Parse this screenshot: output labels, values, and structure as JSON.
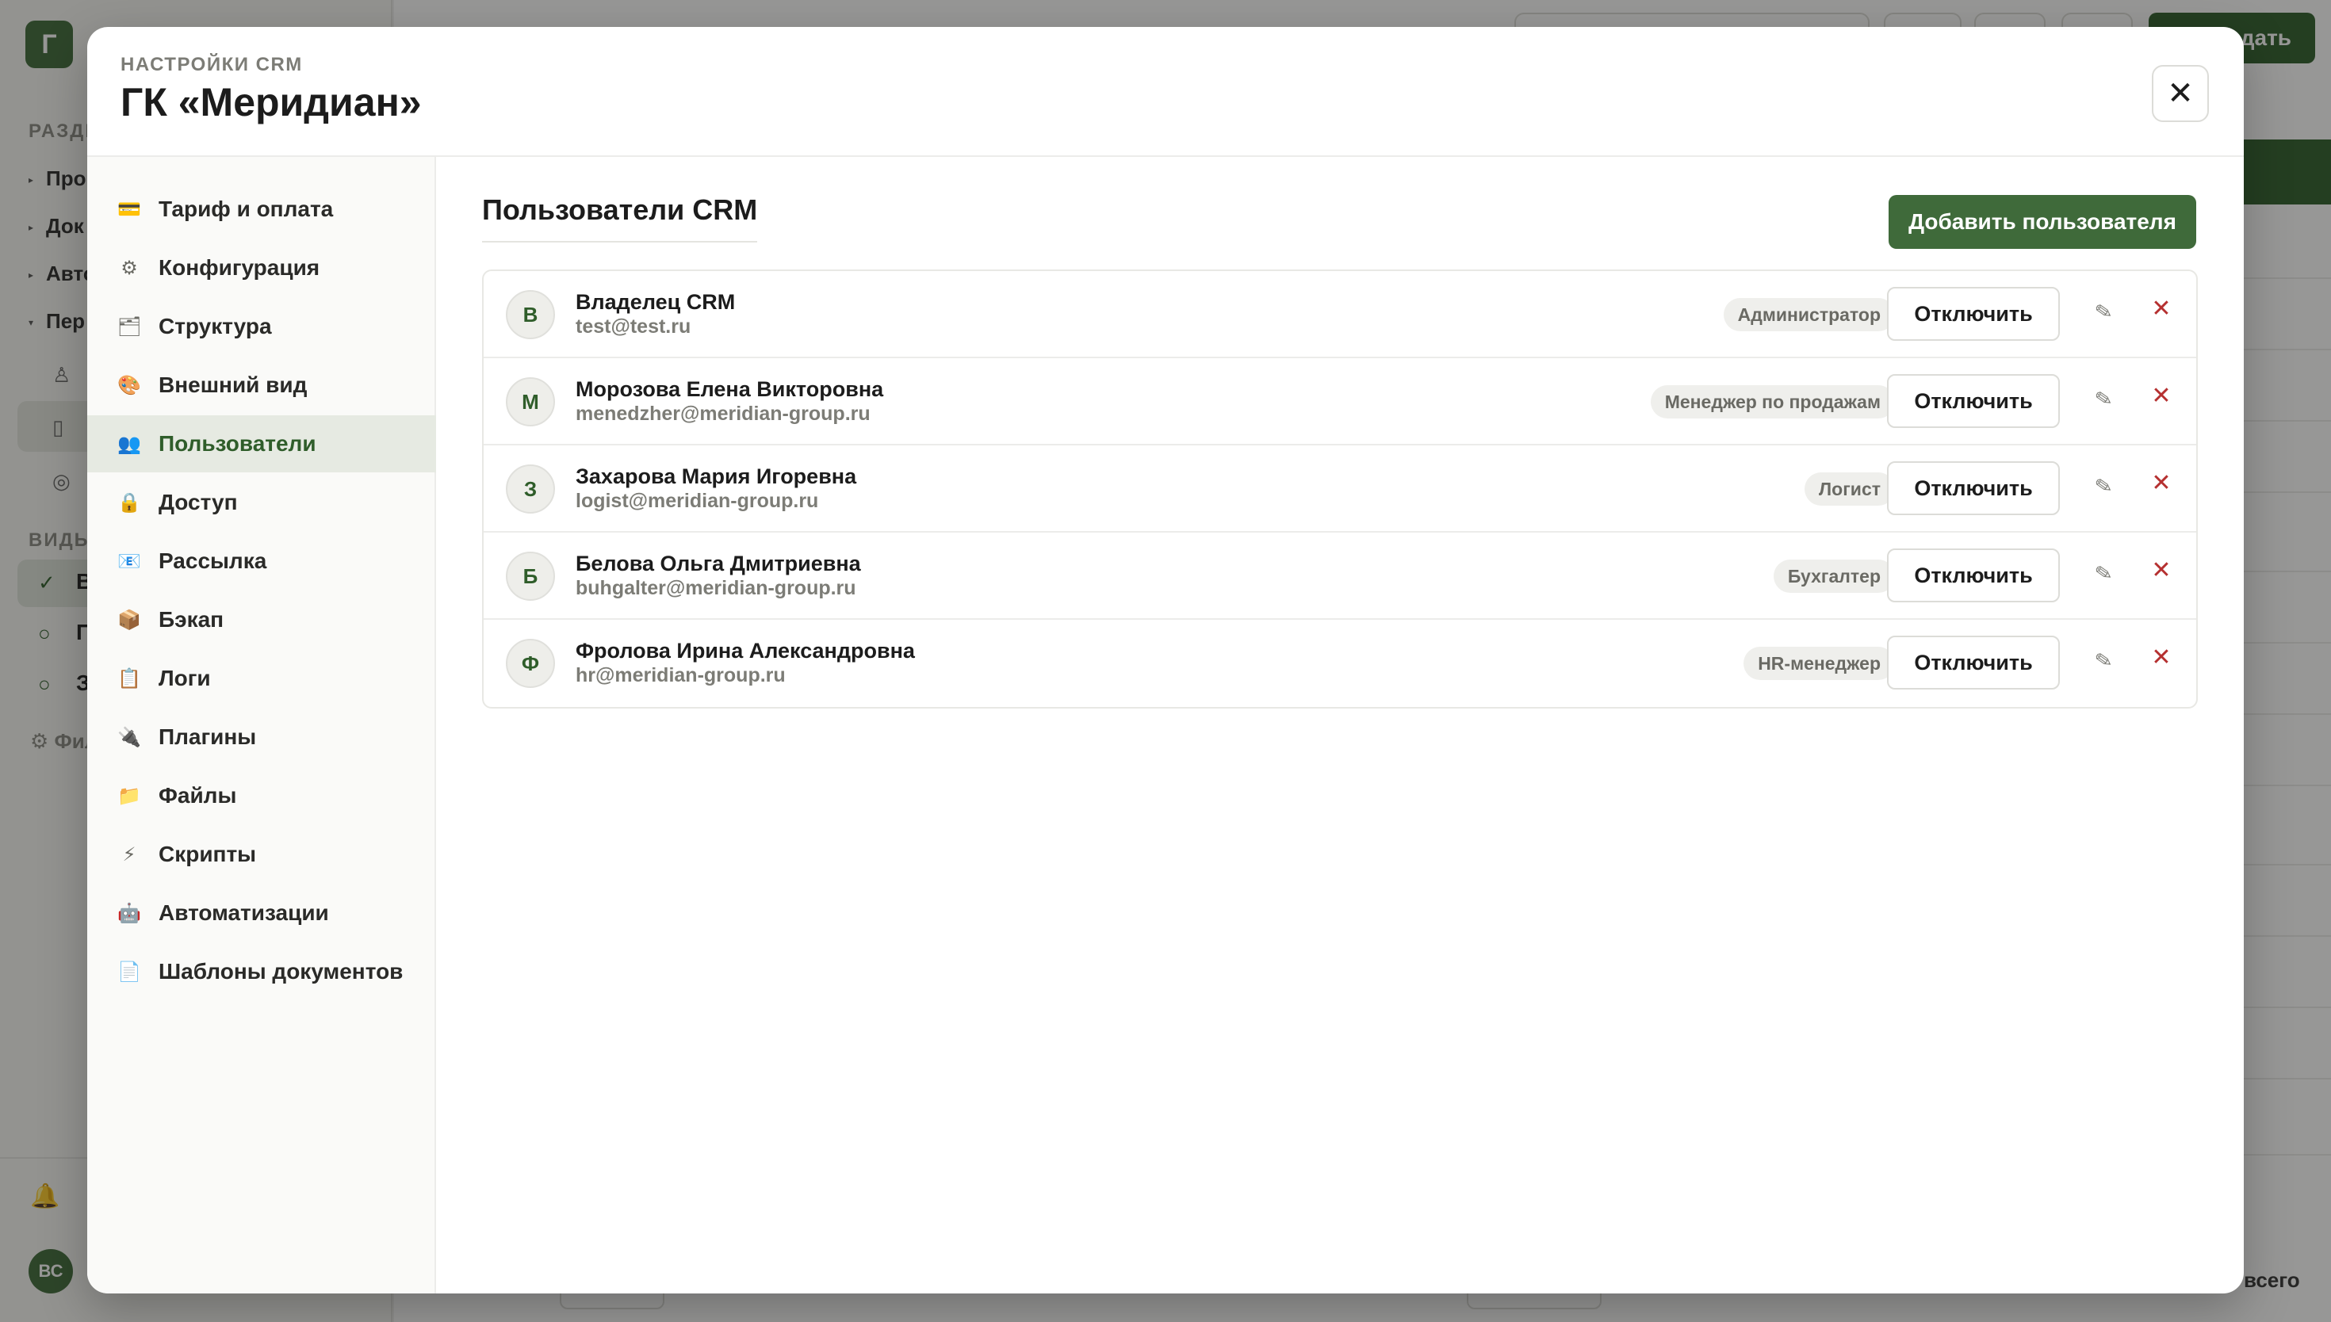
{
  "background": {
    "logo_letter": "Г",
    "section_label": "РАЗДЕ",
    "nav_items": [
      "Про",
      "Док",
      "Авто",
      "Пер"
    ],
    "views_label": "ВИДЫ",
    "view_items": [
      "В",
      "П",
      "З"
    ],
    "filter_label": "⚙ Фил",
    "avatar_initials": "ВС",
    "create_button": "дать",
    "footer_total": "всего"
  },
  "modal": {
    "eyebrow": "НАСТРОЙКИ CRM",
    "title": "ГК «Меридиан»",
    "close_label": "✕"
  },
  "nav": {
    "items": [
      {
        "label": "Тариф и оплата",
        "icon": "💳"
      },
      {
        "label": "Конфигурация",
        "icon": "⚙"
      },
      {
        "label": "Структура",
        "icon": "🗂"
      },
      {
        "label": "Внешний вид",
        "icon": "🎨"
      },
      {
        "label": "Пользователи",
        "icon": "👥"
      },
      {
        "label": "Доступ",
        "icon": "🔒"
      },
      {
        "label": "Рассылка",
        "icon": "📧"
      },
      {
        "label": "Бэкап",
        "icon": "📦"
      },
      {
        "label": "Логи",
        "icon": "📋"
      },
      {
        "label": "Плагины",
        "icon": "🔌"
      },
      {
        "label": "Файлы",
        "icon": "📁"
      },
      {
        "label": "Скрипты",
        "icon": "⚡"
      },
      {
        "label": "Автоматизации",
        "icon": "🤖"
      },
      {
        "label": "Шаблоны документов",
        "icon": "📄"
      }
    ],
    "active": "Пользователи"
  },
  "users_section": {
    "title": "Пользователи CRM",
    "add_button": "Добавить пользователя",
    "disable_label": "Отключить",
    "edit_icon": "✎",
    "delete_icon": "✕",
    "users": [
      {
        "initial": "В",
        "name": "Владелец CRM",
        "email": "test@test.ru",
        "role": "Администратор"
      },
      {
        "initial": "М",
        "name": "Морозова Елена Викторовна",
        "email": "menedzher@meridian-group.ru",
        "role": "Менеджер по продажам"
      },
      {
        "initial": "З",
        "name": "Захарова Мария Игоревна",
        "email": "logist@meridian-group.ru",
        "role": "Логист"
      },
      {
        "initial": "Б",
        "name": "Белова Ольга Дмитриевна",
        "email": "buhgalter@meridian-group.ru",
        "role": "Бухгалтер"
      },
      {
        "initial": "Ф",
        "name": "Фролова Ирина Александровна",
        "email": "hr@meridian-group.ru",
        "role": "HR-менеджер"
      }
    ]
  },
  "colors": {
    "brand_green": "#3f6a3a",
    "active_nav_bg": "#e6eae2",
    "danger_red": "#b53030"
  }
}
